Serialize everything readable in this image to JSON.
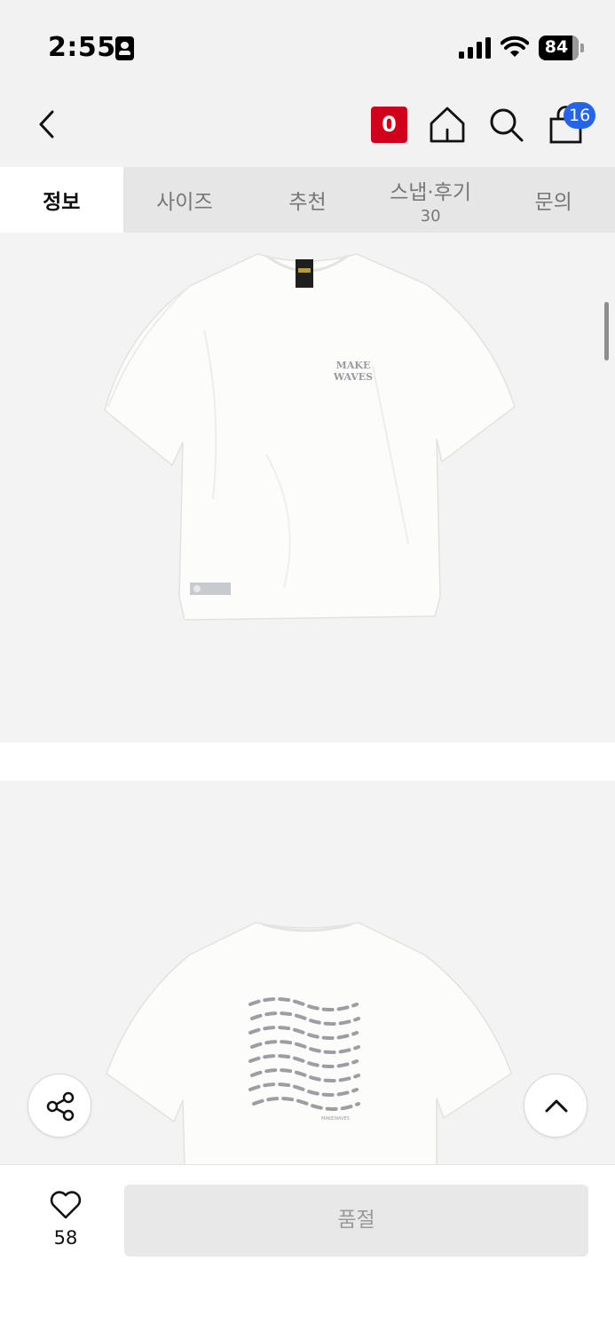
{
  "status_bar": {
    "time": "2:55",
    "battery": "84"
  },
  "header": {
    "point_badge": "0",
    "cart_count": "16"
  },
  "tabs": [
    {
      "label": "정보",
      "active": true
    },
    {
      "label": "사이즈"
    },
    {
      "label": "추천"
    },
    {
      "label": "스냅·후기",
      "count": "30"
    },
    {
      "label": "문의"
    }
  ],
  "product_images": {
    "front_print": [
      "MAKE",
      "WAVES"
    ],
    "back_tag": "MAKEWAVES"
  },
  "bottom_bar": {
    "like_count": "58",
    "purchase_label": "품절"
  },
  "colors": {
    "badge_red": "#d0021b",
    "cart_badge_blue": "#2563eb",
    "tab_inactive_bg": "#e6e6e6",
    "soldout_bg": "#e8e8e8"
  },
  "icons": [
    "id-card-icon",
    "cellular-signal-icon",
    "wifi-icon",
    "battery-icon",
    "back-arrow-icon",
    "home-icon",
    "search-icon",
    "shopping-bag-icon",
    "share-icon",
    "chevron-up-icon",
    "heart-icon"
  ]
}
